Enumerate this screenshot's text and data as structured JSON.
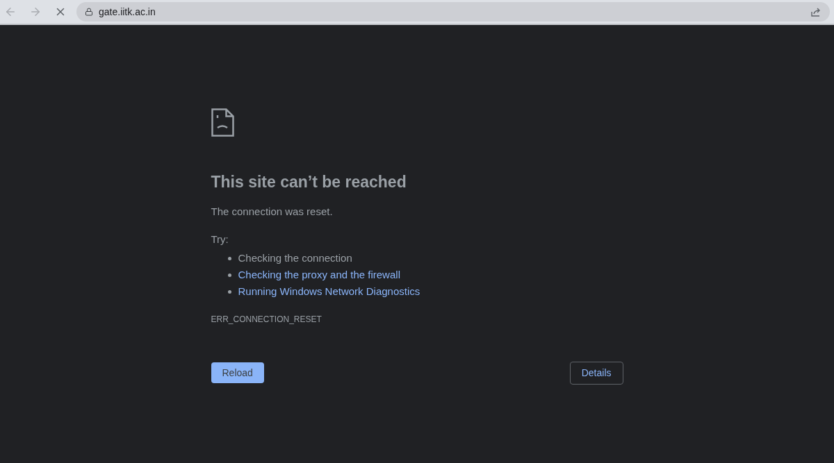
{
  "browser": {
    "url": "gate.iitk.ac.in",
    "loading": true
  },
  "error": {
    "title": "This site can’t be reached",
    "message": "The connection was reset.",
    "try_label": "Try:",
    "suggestions": [
      {
        "kind": "text",
        "text": "Checking the connection"
      },
      {
        "kind": "link",
        "text": "Checking the proxy and the firewall"
      },
      {
        "kind": "link",
        "text": "Running Windows Network Diagnostics"
      }
    ],
    "code": "ERR_CONNECTION_RESET"
  },
  "buttons": {
    "reload": "Reload",
    "details": "Details"
  }
}
